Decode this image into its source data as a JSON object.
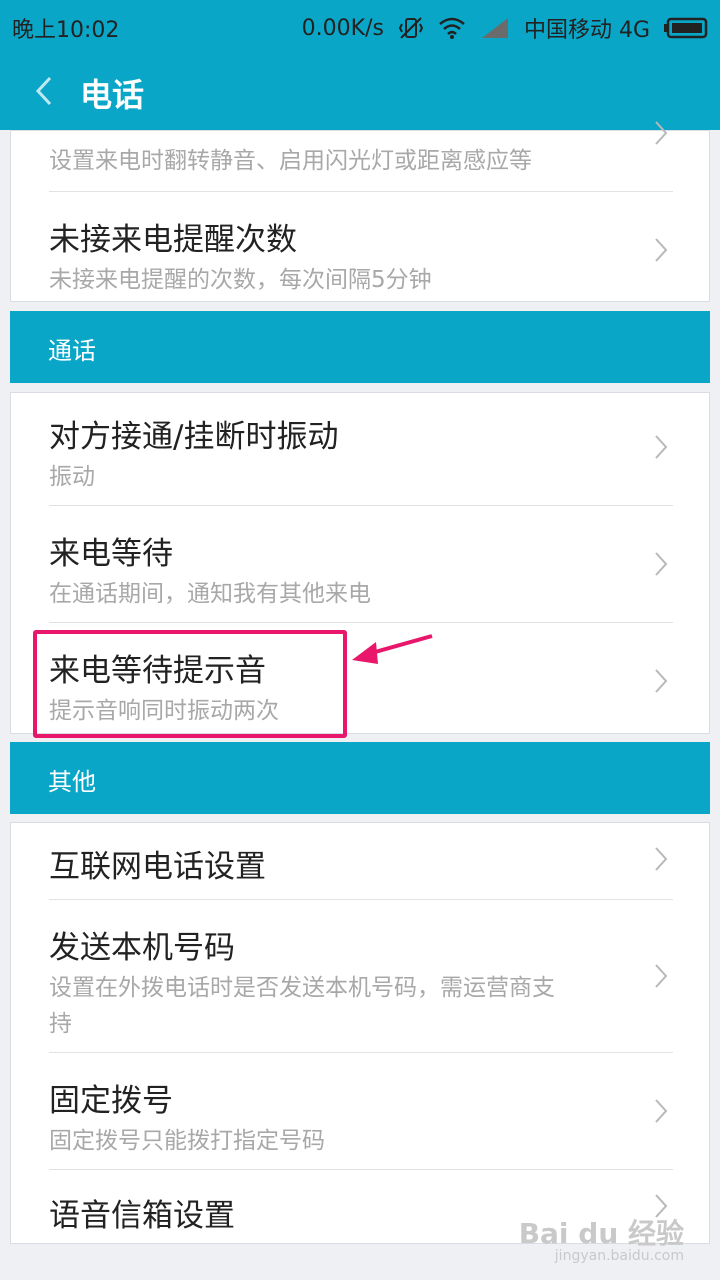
{
  "status_bar": {
    "time": "晚上10:02",
    "speed": "0.00K/s",
    "carrier": "中国移动 4G"
  },
  "app_bar": {
    "title": "电话"
  },
  "sections": {
    "top": {
      "partial_item": {
        "subtitle": "设置来电时翻转静音、启用闪光灯或距离感应等"
      },
      "missed_reminder": {
        "title": "未接来电提醒次数",
        "subtitle": "未接来电提醒的次数，每次间隔5分钟"
      }
    },
    "call": {
      "header": "通话",
      "items": [
        {
          "title": "对方接通/挂断时振动",
          "subtitle": "振动"
        },
        {
          "title": "来电等待",
          "subtitle": "在通话期间，通知我有其他来电"
        },
        {
          "title": "来电等待提示音",
          "subtitle": "提示音响同时振动两次"
        }
      ]
    },
    "other": {
      "header": "其他",
      "items": [
        {
          "title": "互联网电话设置"
        },
        {
          "title": "发送本机号码",
          "subtitle_line1": "设置在外拨电话时是否发送本机号码，需运营商支",
          "subtitle_line2": "持"
        },
        {
          "title": "固定拨号",
          "subtitle": "固定拨号只能拨打指定号码"
        },
        {
          "title": "语音信箱设置"
        }
      ]
    }
  },
  "watermark": {
    "brand": "Bai du 经验",
    "url": "jingyan.baidu.com"
  },
  "colors": {
    "accent": "#0aa6c7",
    "highlight": "#e8176b"
  },
  "icons": [
    "back-arrow-icon",
    "chevron-right-icon",
    "vibrate-off-icon",
    "wifi-icon",
    "signal-icon",
    "battery-icon",
    "pointer-arrow-icon"
  ]
}
